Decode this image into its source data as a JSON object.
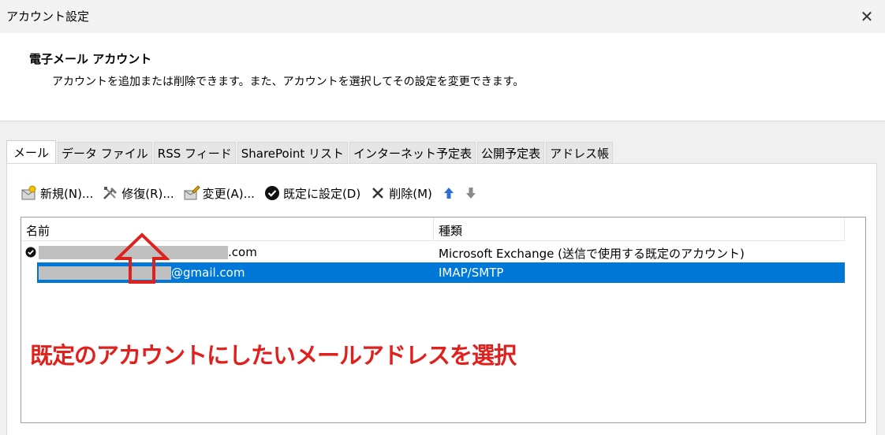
{
  "window": {
    "title": "アカウント設定",
    "close_label": "✕"
  },
  "header": {
    "title": "電子メール アカウント",
    "description": "アカウントを追加または削除できます。また、アカウントを選択してその設定を変更できます。"
  },
  "tabs": [
    "メール",
    "データ ファイル",
    "RSS フィード",
    "SharePoint リスト",
    "インターネット予定表",
    "公開予定表",
    "アドレス帳"
  ],
  "toolbar": {
    "new_label": "新規(N)...",
    "repair_label": "修復(R)...",
    "change_label": "変更(A)...",
    "set_default_label": "既定に設定(D)",
    "delete_label": "削除(M)"
  },
  "list": {
    "columns": [
      "名前",
      "種類"
    ],
    "rows": [
      {
        "name_suffix": ".com",
        "type": "Microsoft Exchange (送信で使用する既定のアカウント)",
        "is_default": true,
        "selected": false
      },
      {
        "name_suffix": "@gmail.com",
        "type": "IMAP/SMTP",
        "is_default": false,
        "selected": true
      }
    ]
  },
  "annotation": {
    "text": "既定のアカウントにしたいメールアドレスを選択",
    "color": "#e0201d"
  },
  "colors": {
    "selection": "#0078d7",
    "annotation": "#e0201d"
  }
}
